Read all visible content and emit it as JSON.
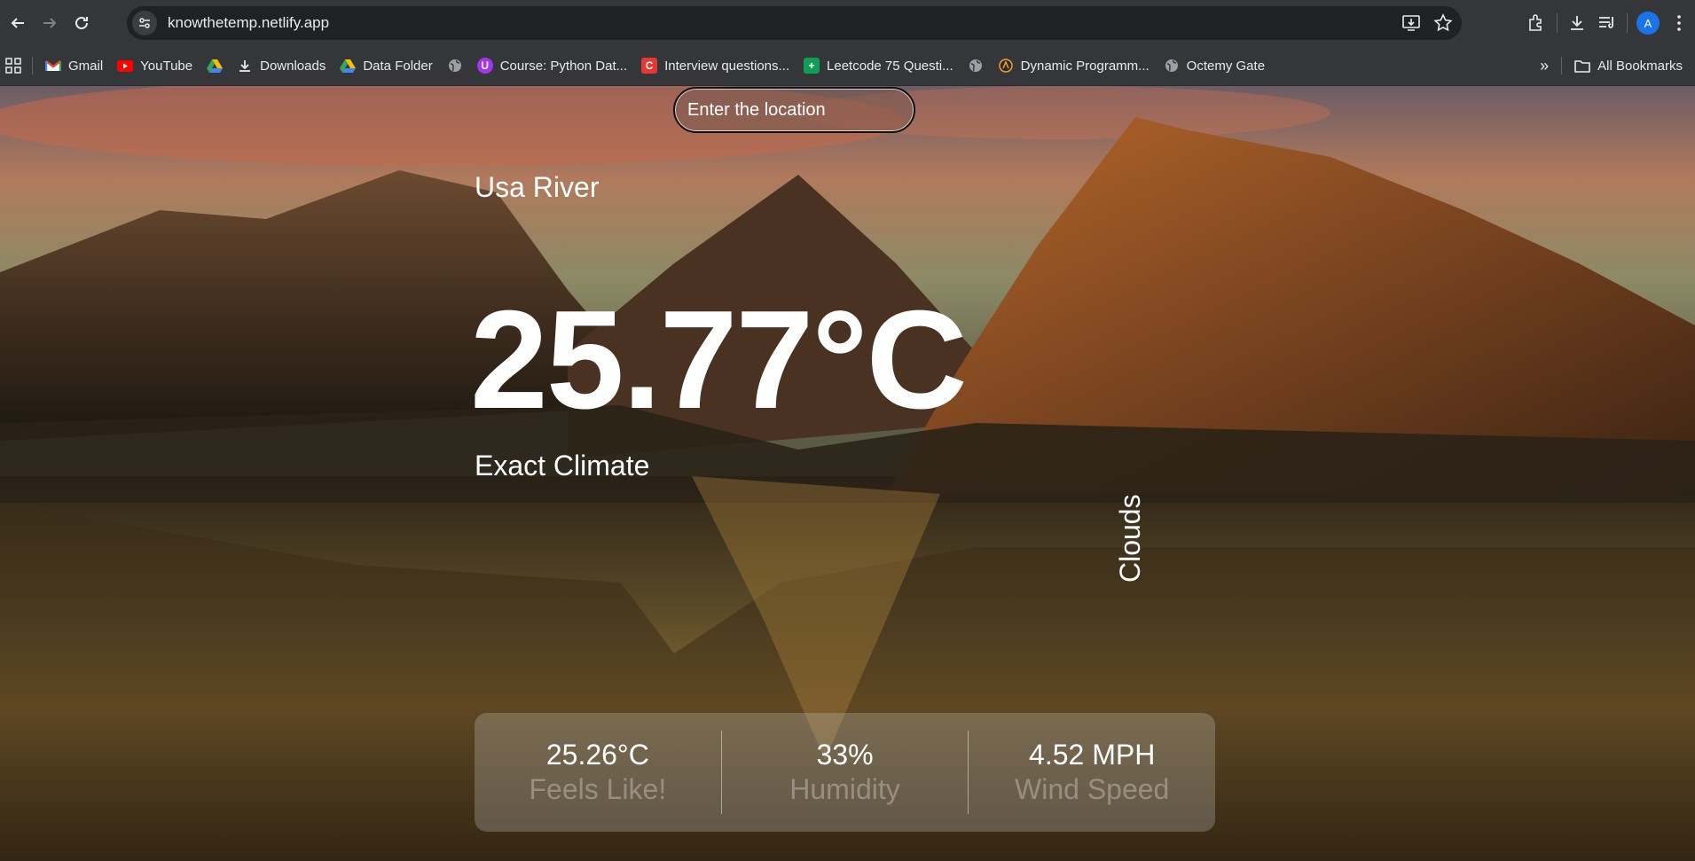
{
  "browser": {
    "url": "knowthetemp.netlify.app",
    "profile_initial": "A",
    "bookmarks": [
      {
        "label": "Gmail",
        "icon": "gmail-icon"
      },
      {
        "label": "YouTube",
        "icon": "youtube-icon"
      },
      {
        "label": "",
        "icon": "drive-icon"
      },
      {
        "label": "Downloads",
        "icon": "download-icon"
      },
      {
        "label": "Data Folder",
        "icon": "drive-icon"
      },
      {
        "label": "",
        "icon": "globe-icon"
      },
      {
        "label": "Course: Python Dat...",
        "icon": "udemy-icon"
      },
      {
        "label": "Interview questions...",
        "icon": "c-icon"
      },
      {
        "label": "Leetcode 75 Questi...",
        "icon": "sheets-icon"
      },
      {
        "label": "",
        "icon": "globe-icon"
      },
      {
        "label": "Dynamic Programm...",
        "icon": "dp-icon"
      },
      {
        "label": "Octemy Gate",
        "icon": "globe-icon"
      }
    ],
    "all_bookmarks": "All Bookmarks",
    "more_chevron": "»"
  },
  "weather": {
    "search_placeholder": "Enter the location",
    "location": "Usa River",
    "temperature": "25.77°C",
    "climate_label": "Exact Climate",
    "condition": "Clouds",
    "feels_like_value": "25.26°C",
    "feels_like_label": "Feels Like!",
    "humidity_value": "33%",
    "humidity_label": "Humidity",
    "wind_value": "4.52 MPH",
    "wind_label": "Wind Speed"
  }
}
